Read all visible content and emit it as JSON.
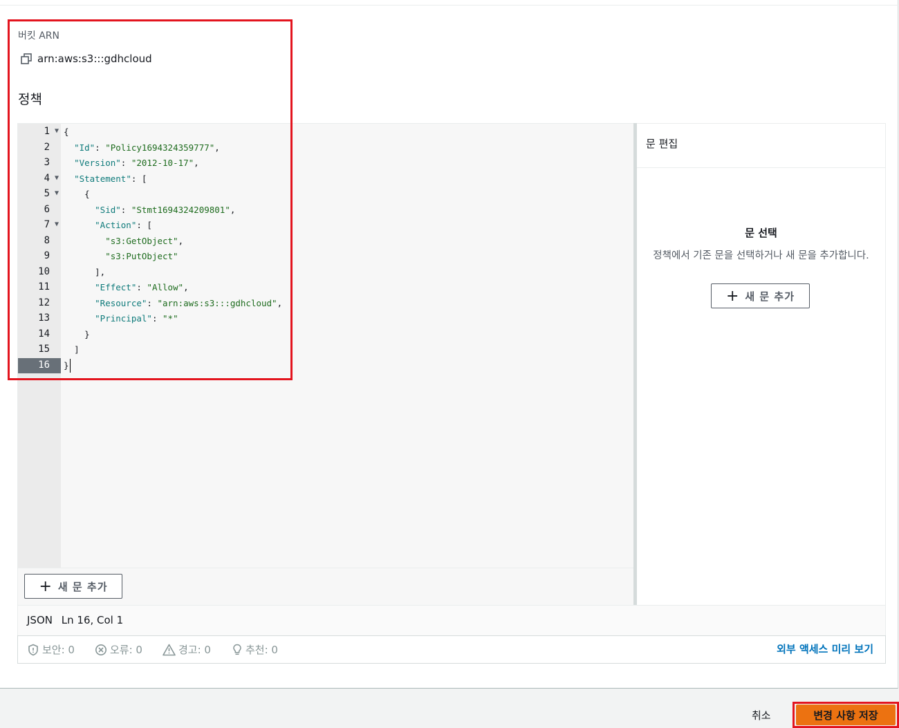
{
  "bucket_arn": {
    "label": "버킷 ARN",
    "value": "arn:aws:s3:::gdhcloud"
  },
  "policy": {
    "title": "정책",
    "lines": [
      {
        "n": "1",
        "fold": true
      },
      {
        "n": "2",
        "fold": false
      },
      {
        "n": "3",
        "fold": false
      },
      {
        "n": "4",
        "fold": true
      },
      {
        "n": "5",
        "fold": true
      },
      {
        "n": "6",
        "fold": false
      },
      {
        "n": "7",
        "fold": true
      },
      {
        "n": "8",
        "fold": false
      },
      {
        "n": "9",
        "fold": false
      },
      {
        "n": "10",
        "fold": false
      },
      {
        "n": "11",
        "fold": false
      },
      {
        "n": "12",
        "fold": false
      },
      {
        "n": "13",
        "fold": false
      },
      {
        "n": "14",
        "fold": false
      },
      {
        "n": "15",
        "fold": false
      },
      {
        "n": "16",
        "fold": false,
        "active": true
      }
    ],
    "code": {
      "l1": "{",
      "l2_key": "\"Id\"",
      "l2_val": "\"Policy1694324359777\"",
      "l3_key": "\"Version\"",
      "l3_val": "\"2012-10-17\"",
      "l4_key": "\"Statement\"",
      "l5": "{",
      "l6_key": "\"Sid\"",
      "l6_val": "\"Stmt1694324209801\"",
      "l7_key": "\"Action\"",
      "l8_val": "\"s3:GetObject\"",
      "l9_val": "\"s3:PutObject\"",
      "l10": "],",
      "l11_key": "\"Effect\"",
      "l11_val": "\"Allow\"",
      "l12_key": "\"Resource\"",
      "l12_val": "\"arn:aws:s3:::gdhcloud\"",
      "l13_key": "\"Principal\"",
      "l13_val": "\"*\"",
      "l14": "}",
      "l15": "]",
      "l16": "}"
    },
    "add_statement_label": "새 문 추가"
  },
  "side_panel": {
    "header": "문 편집",
    "empty_title": "문 선택",
    "empty_desc": "정책에서 기존 문을 선택하거나 새 문을 추가합니다.",
    "add_statement_label": "새 문 추가"
  },
  "status": {
    "language": "JSON",
    "position": "Ln 16, Col 1"
  },
  "diagnostics": {
    "security": "보안: 0",
    "errors": "오류: 0",
    "warnings": "경고: 0",
    "suggestions": "추천: 0",
    "preview_link": "외부 액세스 미리 보기"
  },
  "footer": {
    "cancel": "취소",
    "save": "변경 사항 저장"
  },
  "colors": {
    "primary_button": "#ec7211",
    "link": "#0073bb",
    "highlight": "#e3141e"
  }
}
